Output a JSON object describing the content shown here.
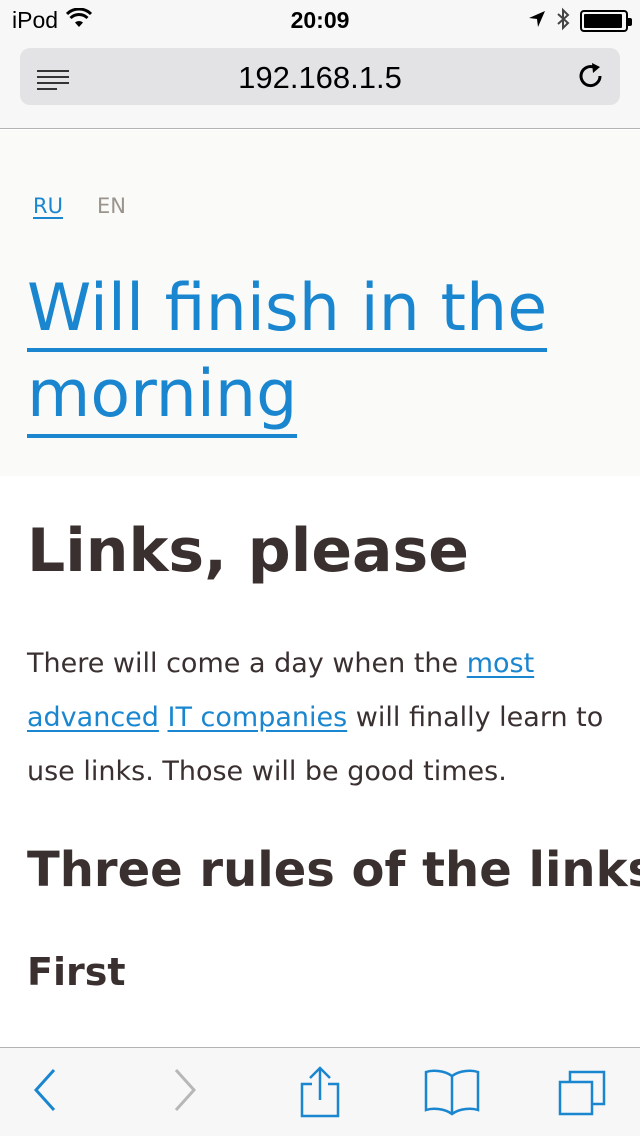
{
  "status_bar": {
    "carrier": "iPod",
    "time": "20:09",
    "battery_level": 0.95
  },
  "browser": {
    "url": "192.168.1.5",
    "reader_icon": "reader-list-icon",
    "reload_icon": "reload-icon"
  },
  "header": {
    "languages": [
      {
        "code": "RU",
        "active": true
      },
      {
        "code": "EN",
        "active": false
      }
    ],
    "site_title": "Will finish in the morning"
  },
  "article": {
    "heading": "Links, please",
    "paragraph": {
      "text_before": "There will come a day when the ",
      "link_most": "most",
      "link_advanced": "advanced",
      "link_it_companies": "IT companies",
      "text_after": " will finally learn to use links. Those will be good times."
    },
    "subheading": "Three rules of the links",
    "subsubheading": "First"
  },
  "toolbar": {
    "buttons": [
      "back-icon",
      "forward-icon",
      "share-icon",
      "bookmarks-icon",
      "tabs-icon"
    ],
    "accent_color": "#1a86cf"
  }
}
